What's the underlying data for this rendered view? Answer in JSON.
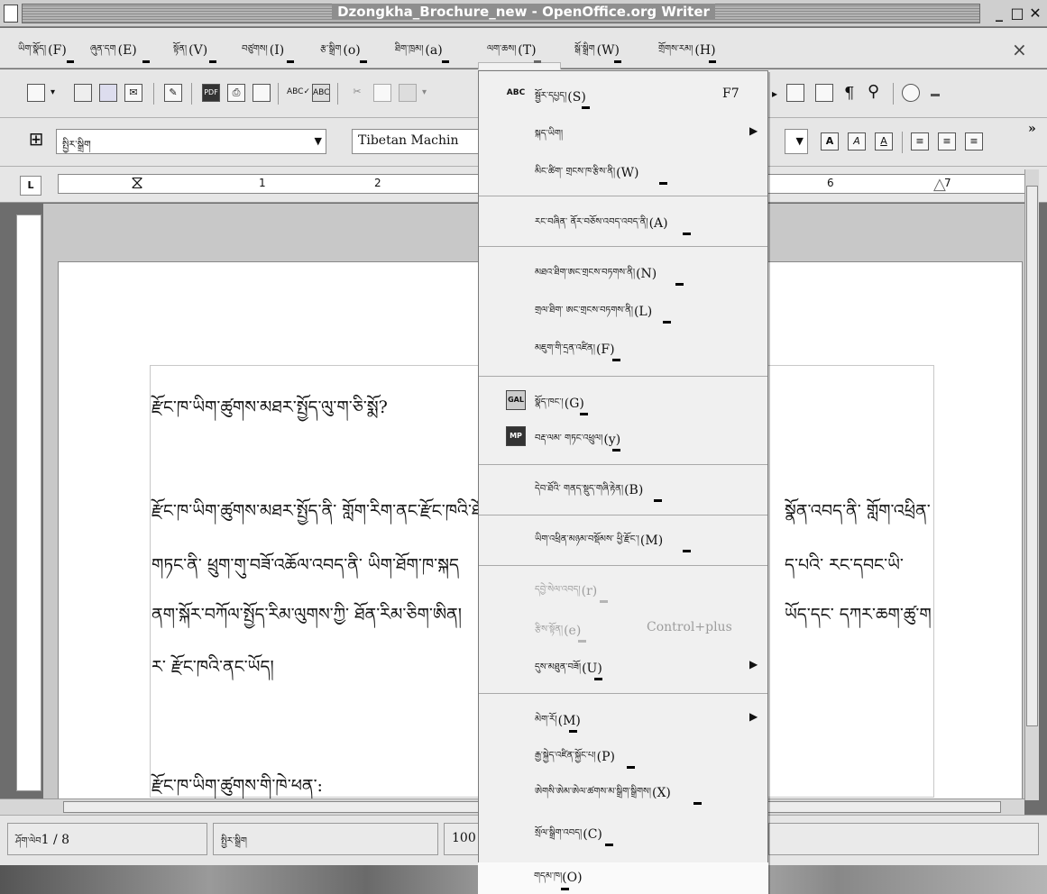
{
  "window": {
    "title": "Dzongkha_Brochure_new - OpenOffice.org Writer",
    "min_label": "_",
    "max_label": "□",
    "close_label": "✕",
    "doc_close_label": "×"
  },
  "menubar": [
    {
      "tib": "ཡིག་སྣོད།",
      "key": "(F)"
    },
    {
      "tib": "ཞུན་དག",
      "key": "(E)"
    },
    {
      "tib": "སྟོན།",
      "key": "(V)"
    },
    {
      "tib": "བཙུགས།",
      "key": "(I)"
    },
    {
      "tib": "རྩ་སྒྲིག",
      "key": "(o)"
    },
    {
      "tib": "ཐིག་ཁྲམ།",
      "key": "(a)"
    },
    {
      "tib": "ལག་ཆས།",
      "key": "(T)"
    },
    {
      "tib": "སྒོ་སྒྲིག",
      "key": "(W)"
    },
    {
      "tib": "གྲོགས་རམ།",
      "key": "(H)"
    }
  ],
  "toolbar": {
    "style_value": "སྤྱིར་སྒྲིག",
    "font_value": "Tibetan Machin",
    "more_label": "»"
  },
  "ruler": {
    "ticks": [
      "1",
      "2",
      "6",
      "7"
    ]
  },
  "document": {
    "lines": [
      "རྫོང་ཁ་ཡིག་ཚུགས་མཐར་སྤྱོད་ལུ་ག་ཅི་སྨོ?",
      "རྫོང་ཁ་ཡིག་ཚུགས་མཐར་སྤྱོད་ནི་ གློག་རིག་ནང་རྫོང་ཁའི་ཐོག",
      "གཏང་ནི་ ཕྲུག་གུ་བཟོ་འཆོལ་འབད་ནི་ ཡིག་ཐོག་ཁ་སྐད",
      "ནག་སྐོར་བཀོལ་སྤྱོད་རིམ་ལུགས་ཀྱི་ ཐོན་རིམ་ཅིག་ཨིན།",
      "ར་ རྫོང་ཁའི་ནང་ཡོད།",
      "རྫོང་ཁ་ཡིག་ཚུགས་གི་ཁེ་ཕན་:"
    ],
    "right_lines": [
      "སྣོན་འབད་ནི་ གློག་འཕྲིན་",
      "ད་པའི་ རང་དབང་ཡི་",
      "ཡོད་དང་ དཀར་ཆག་ཚུ་ག"
    ]
  },
  "statusbar": {
    "page_label": "ཤོག་ལེབ",
    "page_value": "1 / 8",
    "style_value": "སྤྱིར་སྒྲིག",
    "zoom_value": "100"
  },
  "tools_menu": {
    "items": [
      {
        "id": "spelling",
        "icon": "ABC",
        "tib": "སྦྱོར་དཔྱད།",
        "key": "(S)",
        "shortcut": "F7",
        "submenu": false,
        "disabled": false
      },
      {
        "id": "language",
        "icon": "",
        "tib": "སྐད་ཡིག།",
        "key": "",
        "shortcut": "",
        "submenu": true,
        "disabled": false
      },
      {
        "id": "word-count",
        "icon": "",
        "tib": "མིང་ཚིག་ གྲངས་ཁ་རྩིས་ནི།",
        "key": "(W)",
        "shortcut": "",
        "submenu": false,
        "disabled": false
      },
      {
        "id": "autocorrect",
        "icon": "",
        "tib": "རང་བཞིན་ ནོར་བཅོས་འབད་འབད་ནི།",
        "key": "(A)",
        "shortcut": "",
        "submenu": false,
        "disabled": false
      },
      {
        "id": "outline-numbering",
        "icon": "",
        "tib": "མཐའ་ཐིག་ཨང་གྲངས་བཏགས་ནི།",
        "key": "(N)",
        "shortcut": "",
        "submenu": false,
        "disabled": false
      },
      {
        "id": "line-numbering",
        "icon": "",
        "tib": "གྲལ་ཐིག་ ཨང་གྲངས་བཏགས་ནི།",
        "key": "(L)",
        "shortcut": "",
        "submenu": false,
        "disabled": false
      },
      {
        "id": "footnotes",
        "icon": "",
        "tib": "མཇུག་གི་དྲན་འཛིན།",
        "key": "(F)",
        "shortcut": "",
        "submenu": false,
        "disabled": false
      },
      {
        "id": "gallery",
        "icon": "GAL",
        "tib": "སྣོད་ཁང་།",
        "key": "(G)",
        "shortcut": "",
        "submenu": false,
        "disabled": false
      },
      {
        "id": "media-player",
        "icon": "MP",
        "tib": "བརྡ་ལམ་ གཏང་འཕྲུལ།",
        "key": "(y)",
        "shortcut": "",
        "submenu": false,
        "disabled": false
      },
      {
        "id": "bibliography",
        "icon": "",
        "tib": "དེབ་ཐོའི་ གནད་སྡུད་གཞི་རྟེན།",
        "key": "(B)",
        "shortcut": "",
        "submenu": false,
        "disabled": false
      },
      {
        "id": "mail-merge",
        "icon": "",
        "tib": "ཡིག་འཕྲིན་མཉམ་བསྡོམས་ ཕྱི་རྫོང་།",
        "key": "(M)",
        "shortcut": "",
        "submenu": false,
        "disabled": false
      },
      {
        "id": "sort",
        "icon": "",
        "tib": "དབྱེ་སེལ་འབད།",
        "key": "(r)",
        "shortcut": "",
        "submenu": false,
        "disabled": true
      },
      {
        "id": "calculate",
        "icon": "",
        "tib": "རྩིས་སྟོན།",
        "key": "(e)",
        "shortcut": "Control+plus",
        "submenu": false,
        "disabled": true
      },
      {
        "id": "update",
        "icon": "",
        "tib": "དུས་མཐུན་བཟོ།",
        "key": "(U)",
        "shortcut": "",
        "submenu": true,
        "disabled": false
      },
      {
        "id": "macros",
        "icon": "",
        "tib": "མེག་རོ།",
        "key": "(M)",
        "shortcut": "",
        "submenu": true,
        "disabled": false
      },
      {
        "id": "extension-manager",
        "icon": "",
        "tib": "རྒྱ་སྐྱེད་འཛིན་སྐྱོང་པ།",
        "key": "(P)",
        "shortcut": "",
        "submenu": false,
        "disabled": false
      },
      {
        "id": "xml-filter",
        "icon": "",
        "tib": "ཨེགསི་ཨེམ་ཨེལ་ཚགས་མ་སྒྲིག་སྒྲིགས།",
        "key": "(X)",
        "shortcut": "",
        "submenu": false,
        "disabled": false
      },
      {
        "id": "customize",
        "icon": "",
        "tib": "སྲོལ་སྒྲིག་འབད།",
        "key": "(C)",
        "shortcut": "",
        "submenu": false,
        "disabled": false
      },
      {
        "id": "options",
        "icon": "",
        "tib": "གདམ་ཁ།",
        "key": "(O)",
        "shortcut": "",
        "submenu": false,
        "disabled": false
      }
    ]
  }
}
